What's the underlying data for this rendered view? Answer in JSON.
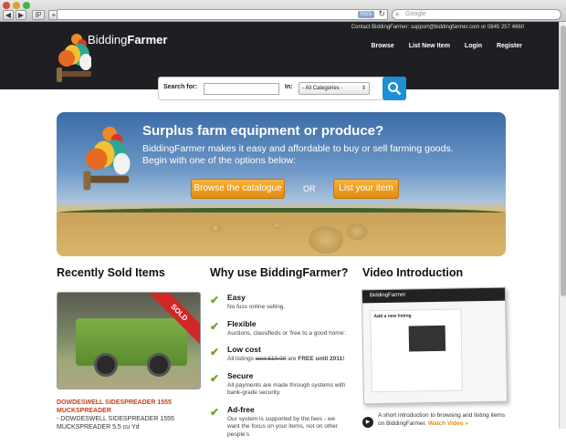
{
  "browser": {
    "back": "◀",
    "forward": "▶",
    "bookmark": "IP",
    "add": "+",
    "rss": "RSS",
    "search_placeholder": "Google"
  },
  "header": {
    "contact": "Contact BiddingFarmer: support@biddingfarmer.com or 0845 257 4660",
    "logo_part1": "Bidding",
    "logo_part2": "Farmer",
    "nav": [
      "Browse",
      "List New Item",
      "Login",
      "Register"
    ]
  },
  "search": {
    "label": "Search for:",
    "value": "",
    "in_label": "In:",
    "category": "- All Categories -"
  },
  "hero": {
    "heading": "Surplus farm equipment or produce?",
    "line1": "BiddingFarmer makes it easy and affordable to buy or sell farming goods.",
    "line2": "Begin with one of the options below:",
    "btn_browse": "Browse the catalogue",
    "or": "OR",
    "btn_list": "List your item"
  },
  "recent": {
    "heading": "Recently Sold Items",
    "badge": "SOLD",
    "item_title": "DOWDESWELL SIDESPREADER 1555 MUCKSPREADER",
    "item_desc": " - DOWDESWELL SIDESPREADER 1555 MUCKSPREADER 5.5 cu Yd"
  },
  "why": {
    "heading": "Why use BiddingFarmer?",
    "items": [
      {
        "title": "Easy",
        "desc": "No fuss online selling."
      },
      {
        "title": "Flexible",
        "desc": "Auctions, classifieds or 'free to a good home'."
      },
      {
        "title": "Low cost",
        "desc_a": "All listings ",
        "desc_strike": "cost £10.00",
        "desc_b": " are ",
        "desc_bold": "FREE until 2011!"
      },
      {
        "title": "Secure",
        "desc": "All payments are made through systems with bank-grade security."
      },
      {
        "title": "Ad-free",
        "desc": "Our system is supported by the fees - we want the focus on your items, not on other people's"
      }
    ]
  },
  "video": {
    "heading": "Video Introduction",
    "thumb_title": "BiddingFarmer",
    "thumb_heading": "Add a new listing",
    "desc": "A short introduction to browsing and listing items on BiddingFarmer.",
    "watch": "Watch Video »"
  },
  "colors": {
    "accent": "#e38a10",
    "header_bg": "#1e1f22",
    "search_btn": "#1c8fd6",
    "sold": "#d02727",
    "tick": "#6aa52a"
  }
}
